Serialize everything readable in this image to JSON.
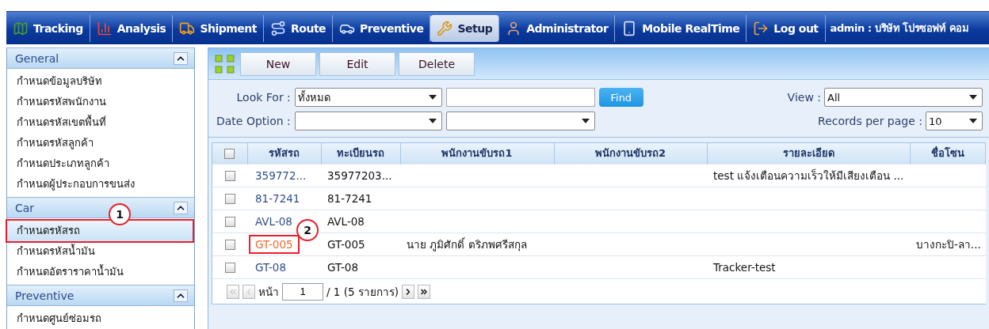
{
  "menu": [
    {
      "label": "Tracking",
      "selected": false
    },
    {
      "label": "Analysis",
      "selected": false
    },
    {
      "label": "Shipment",
      "selected": false
    },
    {
      "label": "Route",
      "selected": false
    },
    {
      "label": "Preventive",
      "selected": false
    },
    {
      "label": "Setup",
      "selected": true
    },
    {
      "label": "Administrator",
      "selected": false
    },
    {
      "label": "Mobile RealTime",
      "selected": false
    },
    {
      "label": "Log out",
      "selected": false
    }
  ],
  "user": "admin : บริษัท โปรซอฟท์ คอม",
  "sidebar": [
    {
      "title": "General",
      "expanded": true,
      "items": [
        {
          "label": "กำหนดข้อมูลบริษัท",
          "selected": false
        },
        {
          "label": "กำหนดรหัสพนักงาน",
          "selected": false
        },
        {
          "label": "กำหนดรหัสเขตพื้นที่",
          "selected": false
        },
        {
          "label": "กำหนดรหัสลูกค้า",
          "selected": false
        },
        {
          "label": "กำหนดประเภทลูกค้า",
          "selected": false
        },
        {
          "label": "กำหนดผู้ประกอบการขนส่ง",
          "selected": false
        }
      ]
    },
    {
      "title": "Car",
      "expanded": true,
      "items": [
        {
          "label": "กำหนดรหัสรถ",
          "selected": true,
          "callout": "1"
        },
        {
          "label": "กำหนดรหัสน้ำมัน",
          "selected": false
        },
        {
          "label": "กำหนดอัตราราคาน้ำมัน",
          "selected": false
        }
      ]
    },
    {
      "title": "Preventive",
      "expanded": true,
      "items": [
        {
          "label": "กำหนดศูนย์ซ่อมรถ",
          "selected": false
        }
      ]
    }
  ],
  "toolbar": [
    "New",
    "Edit",
    "Delete"
  ],
  "filters": {
    "look_for_label": "Look For :",
    "look_for_value": "ทั้งหมด",
    "find": "Find",
    "date_option_label": "Date Option :",
    "view_label": "View :",
    "view_value": "All",
    "records_label": "Records per page :",
    "records_value": "10"
  },
  "table": {
    "select_all_checked": false,
    "columns": [
      "รหัสรถ",
      "ทะเบียนรถ",
      "พนักงานขับรถ1",
      "พนักงานขับรถ2",
      "รายละเอียด",
      "ชื่อโซน"
    ],
    "rows": [
      {
        "checked": false,
        "highlighted": false,
        "cells": [
          "359772...",
          "35977203...",
          "",
          "",
          "test แจ้งเตือนความเร็วให้มีเสียงเตือน ...",
          ""
        ]
      },
      {
        "checked": false,
        "highlighted": false,
        "cells": [
          "81-7241",
          "81-7241",
          "",
          "",
          "",
          ""
        ]
      },
      {
        "checked": false,
        "highlighted": false,
        "cells": [
          "AVL-08",
          "AVL-08",
          "",
          "",
          "",
          ""
        ]
      },
      {
        "checked": false,
        "highlighted": true,
        "callout": "2",
        "cells": [
          "GT-005",
          "GT-005",
          "นาย ภูมิศักดิ์ ตริภพศรีสกุล",
          "",
          "",
          "บางกะปิ-ลา..."
        ]
      },
      {
        "checked": false,
        "highlighted": false,
        "cells": [
          "GT-08",
          "GT-08",
          "",
          "",
          "Tracker-test",
          ""
        ]
      }
    ]
  },
  "pager": {
    "page_label": "หน้า",
    "page": "1",
    "summary": "/ 1 (5 รายการ)"
  }
}
